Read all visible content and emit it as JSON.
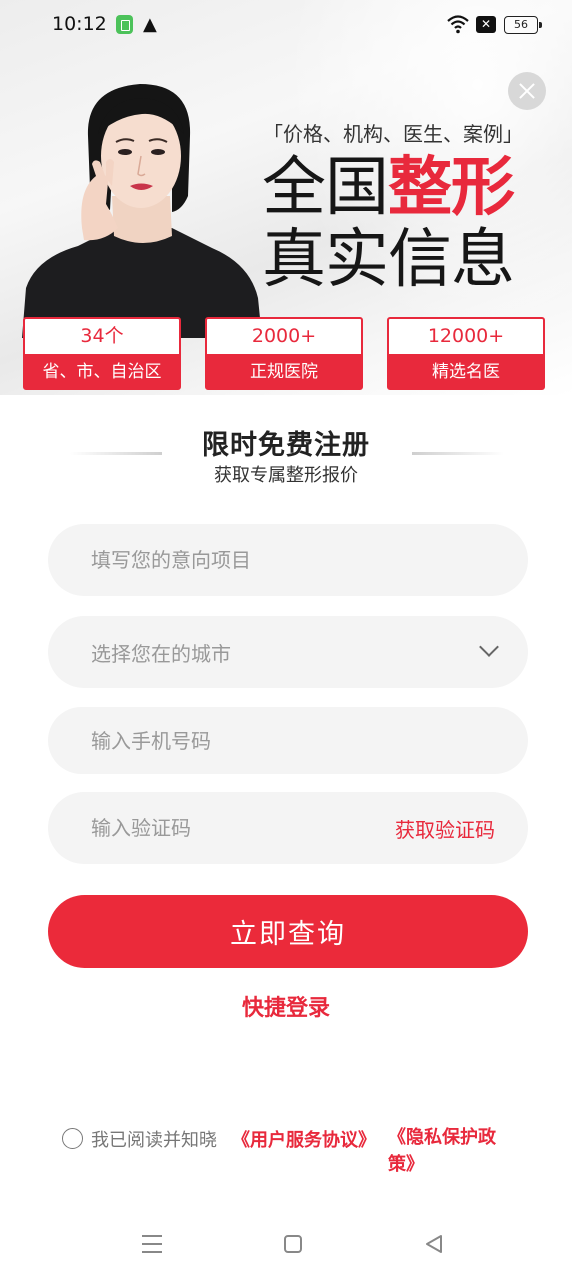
{
  "status_bar": {
    "time": "10:12",
    "battery": "56",
    "icons": [
      "app-notification-icon",
      "warning-icon",
      "wifi-icon",
      "no-sim-icon",
      "battery-icon"
    ]
  },
  "hero": {
    "tagline": "「价格、机构、医生、案例」",
    "title_part1": "全国",
    "title_highlight": "整形",
    "title_line2": "真实信息",
    "accent_color": "#e8293c",
    "stats": [
      {
        "number": "34个",
        "label": "省、市、自治区"
      },
      {
        "number": "2000+",
        "label": "正规医院"
      },
      {
        "number": "12000+",
        "label": "精选名医"
      }
    ]
  },
  "registration": {
    "title": "限时免费注册",
    "subtitle": "获取专属整形报价"
  },
  "form": {
    "project_placeholder": "填写您的意向项目",
    "city_placeholder": "选择您在的城市",
    "phone_placeholder": "输入手机号码",
    "code_placeholder": "输入验证码",
    "get_code_label": "获取验证码",
    "submit_label": "立即查询",
    "quick_login_label": "快捷登录"
  },
  "agreement": {
    "prefix": "我已阅读并知晓",
    "user_agreement": "《用户服务协议》",
    "privacy_policy": "《隐私保护政策》"
  }
}
